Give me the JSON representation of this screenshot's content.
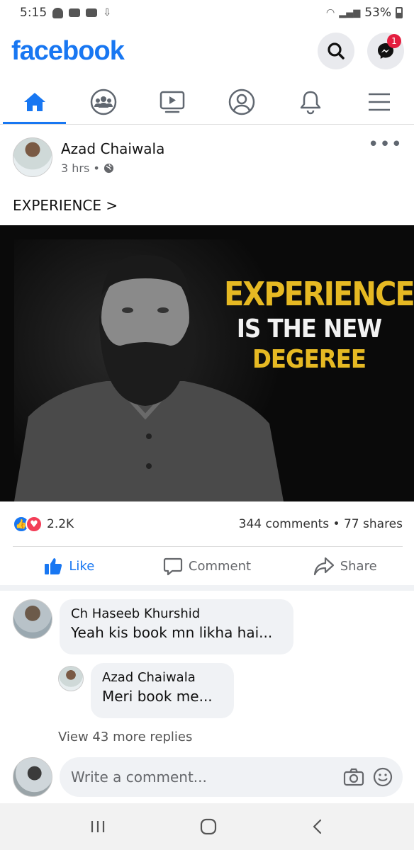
{
  "status_bar": {
    "time": "5:15",
    "battery": "53%"
  },
  "header": {
    "logo": "facebook",
    "messenger_badge": "1"
  },
  "tabs": [
    {
      "name": "home",
      "icon": "home-icon",
      "active": true
    },
    {
      "name": "groups",
      "icon": "groups-icon",
      "active": false
    },
    {
      "name": "watch",
      "icon": "video-icon",
      "active": false
    },
    {
      "name": "profile",
      "icon": "profile-icon",
      "active": false
    },
    {
      "name": "notifications",
      "icon": "bell-icon",
      "active": false
    },
    {
      "name": "menu",
      "icon": "menu-icon",
      "active": false
    }
  ],
  "post": {
    "author": "Azad Chaiwala",
    "time": "3 hrs",
    "text": "EXPERIENCE >",
    "image_headline": {
      "line1": "EXPERIENCE",
      "line2": "IS THE NEW",
      "line3": "DEGEREE"
    },
    "reaction_count": "2.2K",
    "stats": "344 comments • 77 shares"
  },
  "actions": {
    "like": "Like",
    "comment": "Comment",
    "share": "Share"
  },
  "comments": [
    {
      "author": "Ch Haseeb Khurshid",
      "text": "Yeah kis book mn likha hai..."
    },
    {
      "author": "Azad Chaiwala",
      "text": "Meri book me..."
    }
  ],
  "view_more_replies": "View 43 more replies",
  "write_comment": {
    "placeholder": "Write a comment..."
  },
  "colors": {
    "brand": "#1877f2",
    "headline_yellow": "#e6b923",
    "badge_red": "#e41e3f"
  }
}
